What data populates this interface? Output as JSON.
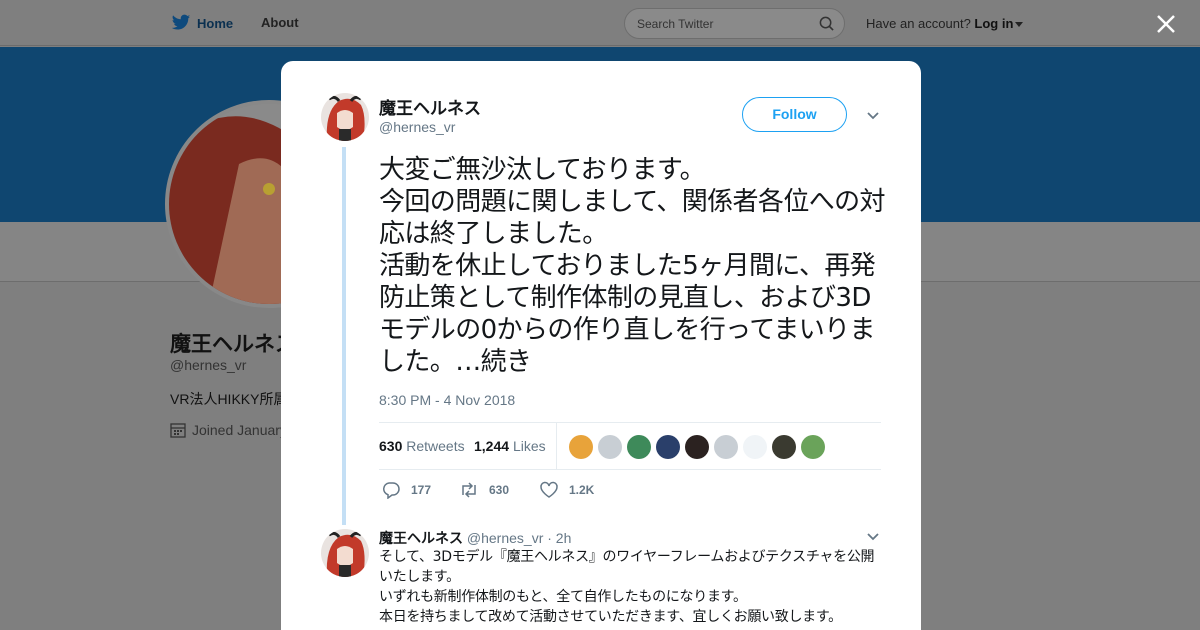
{
  "nav": {
    "home_label": "Home",
    "about_label": "About",
    "search_placeholder": "Search Twitter",
    "have_account": "Have an account?",
    "login_label": "Log in"
  },
  "background_profile": {
    "name": "魔王ヘルネス",
    "handle": "@hernes_vr",
    "bio": "VR法人HIKKY所属",
    "joined": "Joined January"
  },
  "tweet": {
    "author_name": "魔王ヘルネス",
    "author_handle": "@hernes_vr",
    "follow_label": "Follow",
    "text": "大変ご無沙汰しております。\n今回の問題に関しまして、関係者各位への対応は終了しました。\n活動を休止しておりました5ヶ月間に、再発防止策として制作体制の見直し、および3Dモデルの0からの作り直しを行ってまいりました。…続き",
    "timestamp": "8:30 PM - 4 Nov 2018",
    "retweets_count": "630",
    "retweets_label": "Retweets",
    "likes_count": "1,244",
    "likes_label": "Likes",
    "reply_count": "177",
    "retweet_action_count": "630",
    "like_action_count": "1.2K"
  },
  "reply": {
    "author_name": "魔王ヘルネス",
    "author_handle": "@hernes_vr",
    "time": "· 2h",
    "text": "そして、3Dモデル『魔王ヘルネス』のワイヤーフレームおよびテクスチャを公開いたします。\nいずれも新制作体制のもと、全て自作したものになります。\n本日を持ちまして改めて活動させていただきます、宜しくお願い致します。"
  },
  "colors": {
    "accent": "#1da1f2",
    "banner": "#0f4670",
    "overlay": "#7f7f7f"
  }
}
